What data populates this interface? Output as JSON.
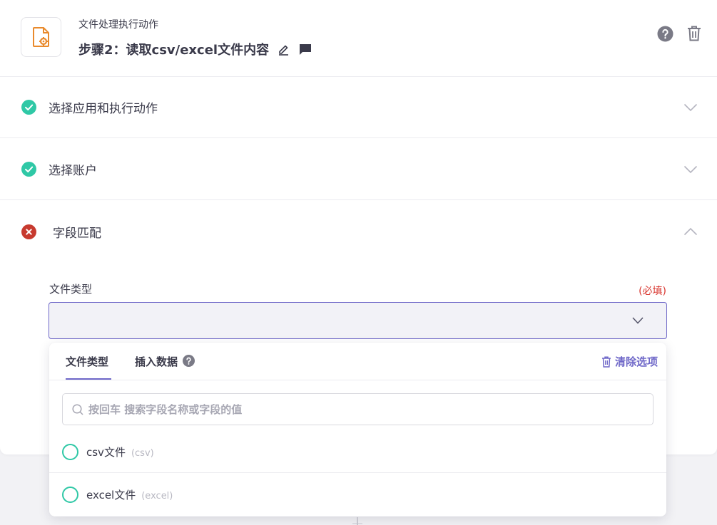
{
  "header": {
    "subtitle": "文件处理执行动作",
    "title": "步骤2：读取csv/excel文件内容",
    "accent_color": "#e98a2c"
  },
  "sections": [
    {
      "label": "选择应用和执行动作",
      "status": "success"
    },
    {
      "label": "选择账户",
      "status": "success"
    },
    {
      "label": "字段匹配",
      "status": "error"
    }
  ],
  "field": {
    "label": "文件类型",
    "required": "(必填)",
    "value": ""
  },
  "dropdown": {
    "tabs": [
      {
        "label": "文件类型",
        "active": true
      },
      {
        "label": "插入数据",
        "active": false
      }
    ],
    "clear_label": "清除选项",
    "search_placeholder": "按回车 搜索字段名称或字段的值",
    "options": [
      {
        "label": "csv文件",
        "hint": "(csv)"
      },
      {
        "label": "excel文件",
        "hint": "(excel)"
      }
    ]
  },
  "colors": {
    "success": "#2fc8a6",
    "error": "#c73a2f",
    "primary": "#6e67c8",
    "required": "#d8342d"
  }
}
